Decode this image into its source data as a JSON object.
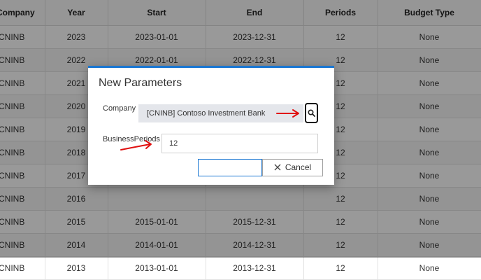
{
  "grid": {
    "columns": [
      "Company",
      "Year",
      "Start",
      "End",
      "Periods",
      "Budget Type"
    ],
    "rows": [
      [
        "CNINB",
        "2023",
        "2023-01-01",
        "2023-12-31",
        "12",
        "None"
      ],
      [
        "CNINB",
        "2022",
        "2022-01-01",
        "2022-12-31",
        "12",
        "None"
      ],
      [
        "CNINB",
        "2021",
        "",
        "",
        "12",
        "None"
      ],
      [
        "CNINB",
        "2020",
        "",
        "",
        "12",
        "None"
      ],
      [
        "CNINB",
        "2019",
        "",
        "",
        "12",
        "None"
      ],
      [
        "CNINB",
        "2018",
        "",
        "",
        "12",
        "None"
      ],
      [
        "CNINB",
        "2017",
        "",
        "",
        "12",
        "None"
      ],
      [
        "CNINB",
        "2016",
        "",
        "",
        "12",
        "None"
      ],
      [
        "CNINB",
        "2015",
        "2015-01-01",
        "2015-12-31",
        "12",
        "None"
      ],
      [
        "CNINB",
        "2014",
        "2014-01-01",
        "2014-12-31",
        "12",
        "None"
      ],
      [
        "CNINB",
        "2013",
        "2013-01-01",
        "2013-12-31",
        "12",
        "None"
      ]
    ]
  },
  "dialog": {
    "title": "New Parameters",
    "company_label": "Company",
    "company_value": "[CNINB] Contoso Investment Bank",
    "periods_label": "BusinessPeriods :",
    "periods_value": "12",
    "ok_label": "",
    "cancel_label": "Cancel"
  },
  "icons": {
    "lookup": "search-icon",
    "cancel": "close-icon",
    "annotation": "arrow-right-icon"
  },
  "colors": {
    "accent": "#1976d2",
    "annotation": "#e01010",
    "field_bg": "#e4e6eb"
  }
}
